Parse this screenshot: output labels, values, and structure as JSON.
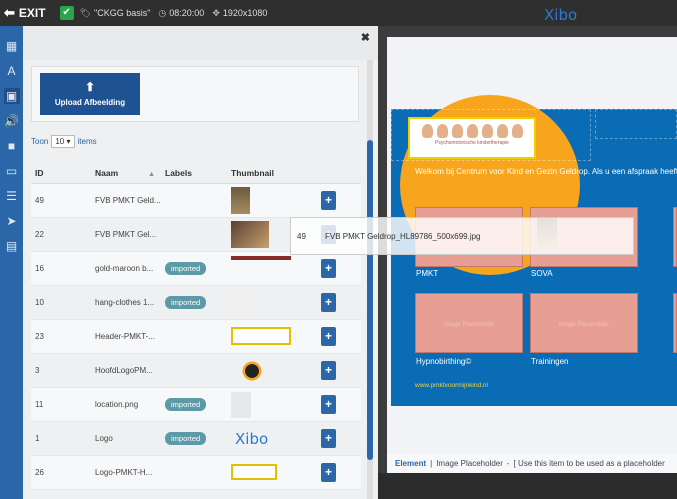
{
  "topbar": {
    "exit_label": "EXIT",
    "layout_name": "\"CKGG basis\"",
    "duration": "08:20:00",
    "resolution": "1920x1080",
    "brand": "Xibo"
  },
  "panel": {
    "upload_label": "Upload Afbeelding",
    "show_prefix": "Toon",
    "show_value": "10",
    "show_suffix": "items",
    "columns": {
      "id": "ID",
      "name": "Naam",
      "labels": "Labels",
      "thumbnail": "Thumbnail"
    },
    "rows": [
      {
        "id": "49",
        "name": "FVB PMKT Geld...",
        "label": ""
      },
      {
        "id": "22",
        "name": "FVB PMKT Gel...",
        "label": ""
      },
      {
        "id": "16",
        "name": "gold-maroon b...",
        "label": "imported"
      },
      {
        "id": "10",
        "name": "hang-clothes 1...",
        "label": "imported"
      },
      {
        "id": "23",
        "name": "Header-PMKT-...",
        "label": ""
      },
      {
        "id": "3",
        "name": "HoofdLogoPM...",
        "label": ""
      },
      {
        "id": "11",
        "name": "location.png",
        "label": "imported"
      },
      {
        "id": "1",
        "name": "Logo",
        "label": "imported"
      },
      {
        "id": "26",
        "name": "Logo-PMKT-H...",
        "label": ""
      }
    ],
    "row_action": "+",
    "logo_thumb_text": "Xibo"
  },
  "drag": {
    "id": "49",
    "name": "FVB PMKT Geldrop_HL89786_500x699.jpg"
  },
  "canvas": {
    "banner_tag": "Psychomotorische kindertherapie",
    "welcome": "Welkom bij Centrum voor Kind en Gezin Geldrop. Als u een afspraak heeft w",
    "tiles": [
      "PMKT",
      "SOVA",
      "Hypnobirthing©",
      "Trainingen"
    ],
    "placeholder_text": "Image Placeholder",
    "weblink": "www.pmktvoormijnkind.nl"
  },
  "statusbar": {
    "type": "Element",
    "sep": "|",
    "name": "Image Placeholder",
    "dash": "-",
    "hint": "[ Use this item to be used as a placeholder"
  },
  "colors": {
    "accent": "#2a66a8",
    "orange": "#f7a51d",
    "blue": "#0a6cb4",
    "tile": "#e79e93",
    "badge": "#5b9aa6"
  }
}
